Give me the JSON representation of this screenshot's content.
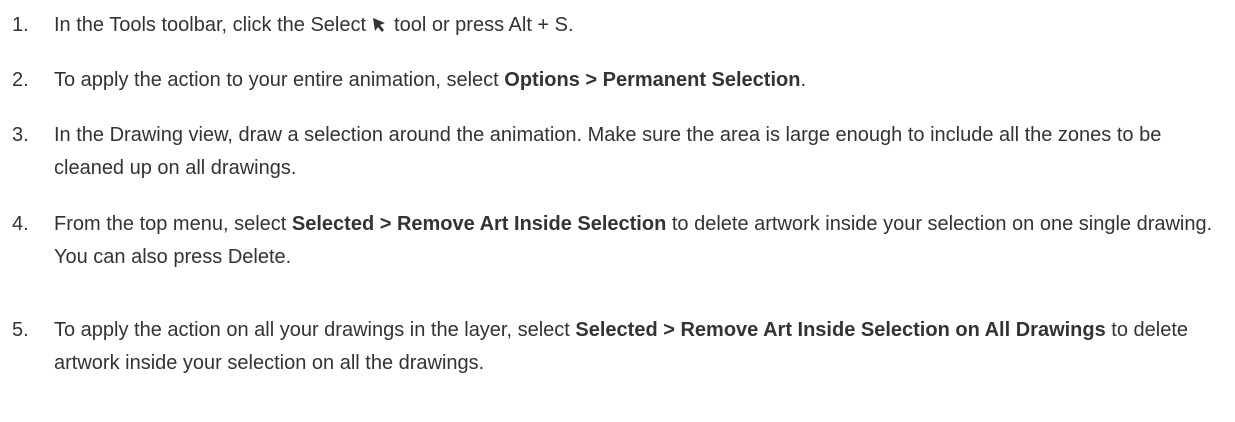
{
  "steps": [
    {
      "number": "1.",
      "text_a": "In the Tools toolbar, click the Select",
      "icon": "select-arrow-icon",
      "text_b": "tool or press Alt + S."
    },
    {
      "number": "2.",
      "text_a": "To apply the action to your entire animation, select ",
      "bold_a": "Options > Permanent Selection",
      "text_b": "."
    },
    {
      "number": "3.",
      "text_a": "In the Drawing view, draw a selection around the animation. Make sure the area is large enough to include all the zones to be cleaned up on all drawings."
    },
    {
      "number": "4.",
      "text_a": "From the top menu, select ",
      "bold_a": "Selected > Remove Art Inside Selection",
      "text_b": " to delete artwork inside your selection on one single drawing. You can also press Delete."
    },
    {
      "number": "5.",
      "text_a": "To apply the action on all your drawings in the layer, select ",
      "bold_a": "Selected > Remove Art Inside Selection on All Drawings",
      "text_b": " to delete artwork inside your selection on all the drawings."
    }
  ],
  "colors": {
    "text": "#333333",
    "background": "#ffffff"
  }
}
